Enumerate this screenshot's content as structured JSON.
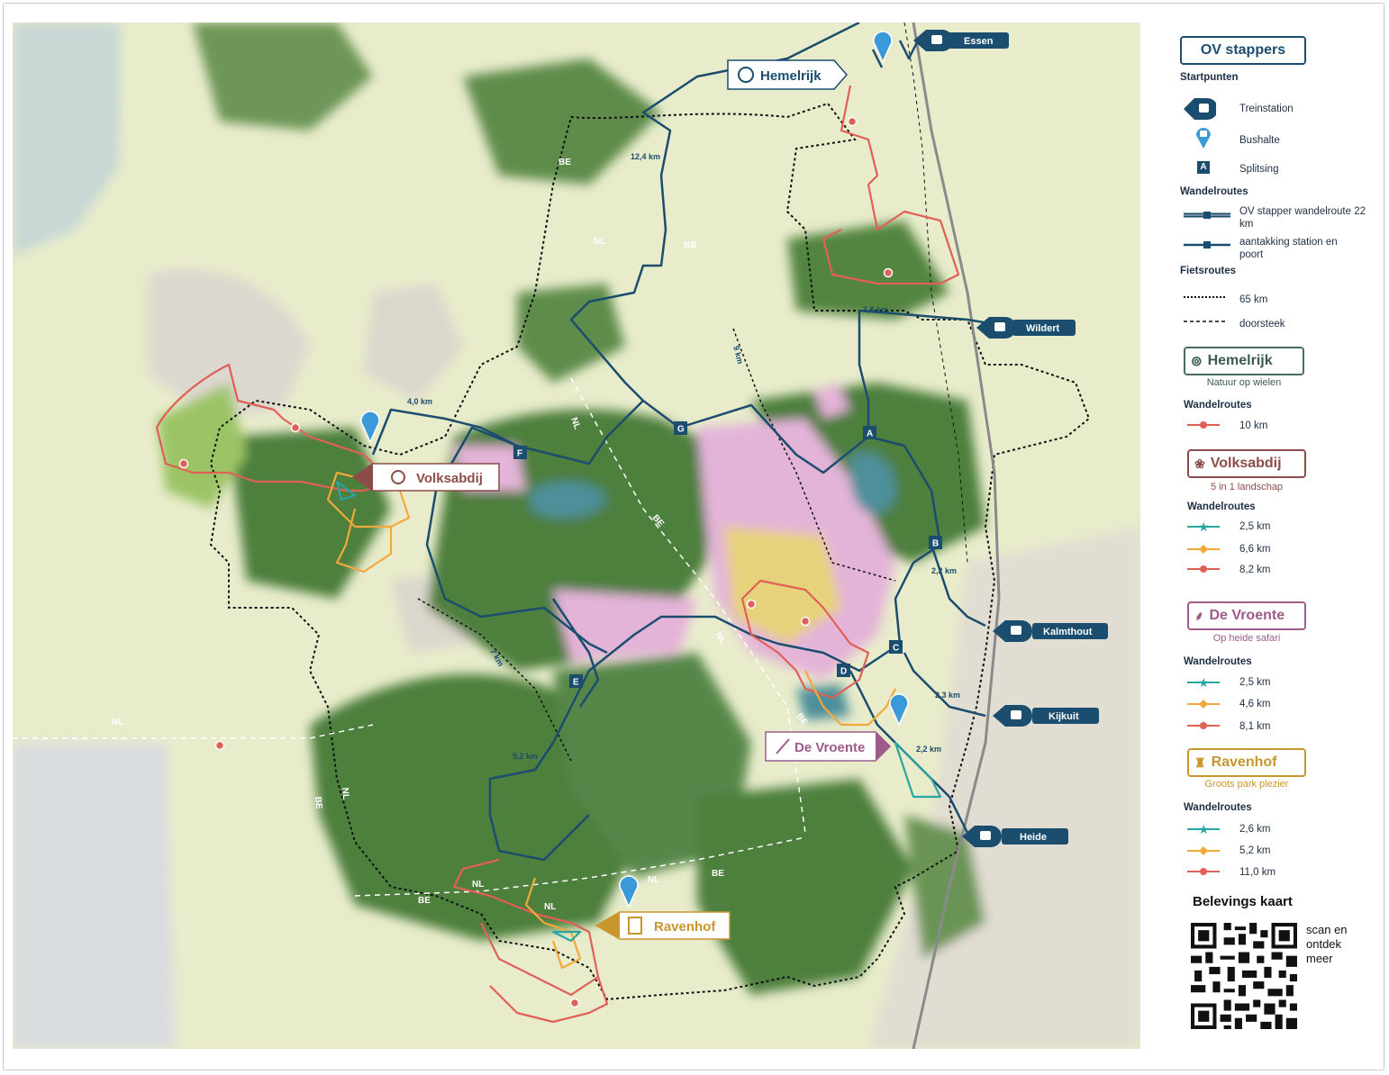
{
  "map": {
    "stations": [
      {
        "name": "Essen",
        "type": "train"
      },
      {
        "name": "Wildert",
        "type": "train"
      },
      {
        "name": "Kalmthout",
        "type": "train"
      },
      {
        "name": "Kijkuit",
        "type": "train"
      },
      {
        "name": "Heide",
        "type": "train"
      }
    ],
    "gates": [
      {
        "name": "Hemelrijk",
        "icon": "bike-wheels-icon",
        "color": "#1b4d6e"
      },
      {
        "name": "Volksabdij",
        "icon": "flower-icon",
        "color": "#8c4d4a"
      },
      {
        "name": "De Vroente",
        "icon": "grass-icon",
        "color": "#9d5b8c"
      },
      {
        "name": "Ravenhof",
        "icon": "castle-icon",
        "color": "#c9962d"
      }
    ],
    "splits": [
      "A",
      "B",
      "C",
      "D",
      "E",
      "F",
      "G"
    ],
    "distances": [
      "12,4 km",
      "3,8 km",
      "4,0 km",
      "9 km",
      "2,2 km",
      "2,3 km",
      "7 km",
      "5,2 km",
      "2,2 km"
    ],
    "border_labels": [
      "BE",
      "NL",
      "BB",
      "NL",
      "BE",
      "NL",
      "BE",
      "NL",
      "NL",
      "BE",
      "BE",
      "NL",
      "BE",
      "NL",
      "NL"
    ]
  },
  "legend": {
    "title": "OV stappers",
    "startpunten": "Startpunten",
    "treinstation": "Treinstation",
    "bushalte": "Bushalte",
    "splitsing": "Splitsing",
    "splitsing_letter": "A",
    "wandelroutes": "Wandelroutes",
    "ov_route": "OV stapper wandelroute 22 km",
    "aantakking": "aantakking station en poort",
    "fietsroutes": "Fietsroutes",
    "fiets_65": "65 km",
    "doorsteek": "doorsteek",
    "hemelrijk": {
      "name": "Hemelrijk",
      "sub": "Natuur op wielen",
      "routes": [
        "10 km"
      ]
    },
    "volksabdij": {
      "name": "Volksabdij",
      "sub": "5 in 1 landschap",
      "routes": [
        "2,5 km",
        "6,6 km",
        "8,2 km"
      ]
    },
    "vroente": {
      "name": "De Vroente",
      "sub": "Op heide safari",
      "routes": [
        "2,5 km",
        "4,6 km",
        "8,1 km"
      ]
    },
    "ravenhof": {
      "name": "Ravenhof",
      "sub": "Groots park plezier",
      "routes": [
        "2,6 km",
        "5,2 km",
        "11,0 km"
      ]
    },
    "belevings": "Belevings kaart",
    "scan": [
      "scan en",
      "ontdek",
      "meer"
    ]
  },
  "colors": {
    "ov_blue": "#1b4d6e",
    "route_red": "#e06058",
    "route_orange": "#f2a93b",
    "route_teal": "#2aa5a1",
    "forest": "#4e7f3e",
    "heath": "#e4b4d8",
    "field": "#e9ecc4"
  }
}
